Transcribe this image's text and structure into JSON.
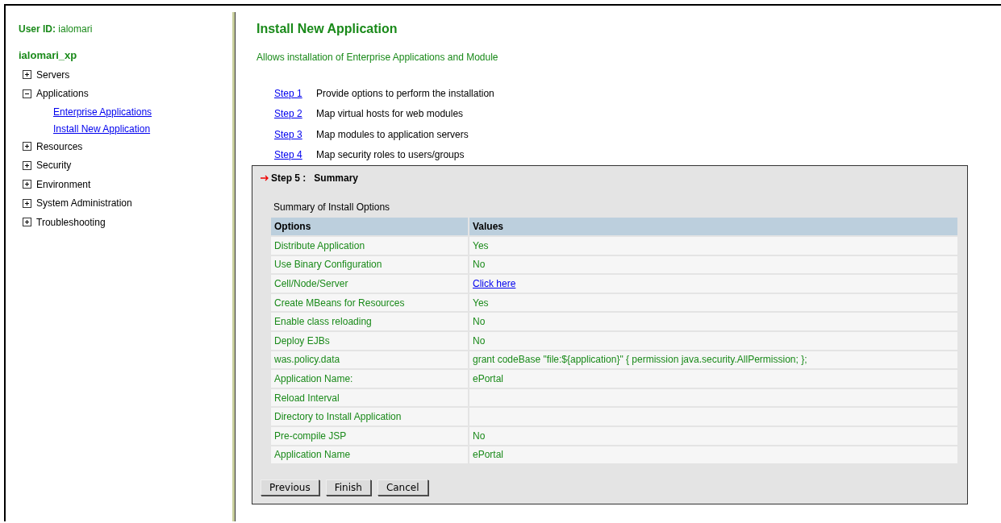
{
  "sidebar": {
    "user_id_label": "User ID:",
    "user_id": "ialomari",
    "node": "ialomari_xp",
    "items": [
      {
        "label": "Servers",
        "expanded": false
      },
      {
        "label": "Applications",
        "expanded": true,
        "children": [
          {
            "label": "Enterprise Applications"
          },
          {
            "label": "Install New Application"
          }
        ]
      },
      {
        "label": "Resources",
        "expanded": false
      },
      {
        "label": "Security",
        "expanded": false
      },
      {
        "label": "Environment",
        "expanded": false
      },
      {
        "label": "System Administration",
        "expanded": false
      },
      {
        "label": "Troubleshooting",
        "expanded": false
      }
    ]
  },
  "page": {
    "title": "Install New Application",
    "description": "Allows installation of Enterprise Applications and Module",
    "steps": [
      {
        "link": "Step 1",
        "text": "Provide options to perform the installation"
      },
      {
        "link": "Step 2",
        "text": "Map virtual hosts for web modules"
      },
      {
        "link": "Step 3",
        "text": "Map modules to application servers"
      },
      {
        "link": "Step 4",
        "text": "Map security roles to users/groups"
      }
    ],
    "current_step": {
      "label": "Step 5 :",
      "title": "Summary"
    },
    "table": {
      "caption": "Summary of Install Options",
      "columns": [
        "Options",
        "Values"
      ],
      "rows": [
        {
          "option": "Distribute Application",
          "value": "Yes",
          "kind": "text"
        },
        {
          "option": "Use Binary Configuration",
          "value": "No",
          "kind": "text"
        },
        {
          "option": "Cell/Node/Server",
          "value": "Click here",
          "kind": "link"
        },
        {
          "option": "Create MBeans for Resources",
          "value": "Yes",
          "kind": "text"
        },
        {
          "option": "Enable class reloading",
          "value": "No",
          "kind": "text"
        },
        {
          "option": "Deploy EJBs",
          "value": "No",
          "kind": "text"
        },
        {
          "option": "was.policy.data",
          "value": "grant codeBase \"file:${application}\" { permission java.security.AllPermission; };",
          "kind": "text"
        },
        {
          "option": "Application Name:",
          "value": "ePortal",
          "kind": "text"
        },
        {
          "option": "Reload Interval"
        },
        {
          "option": "Directory to Install Application"
        },
        {
          "option": "Pre-compile JSP",
          "value": "No",
          "kind": "text"
        },
        {
          "option": "Application Name",
          "value": "ePortal",
          "kind": "text"
        }
      ]
    },
    "buttons": [
      "Previous",
      "Finish",
      "Cancel"
    ]
  }
}
